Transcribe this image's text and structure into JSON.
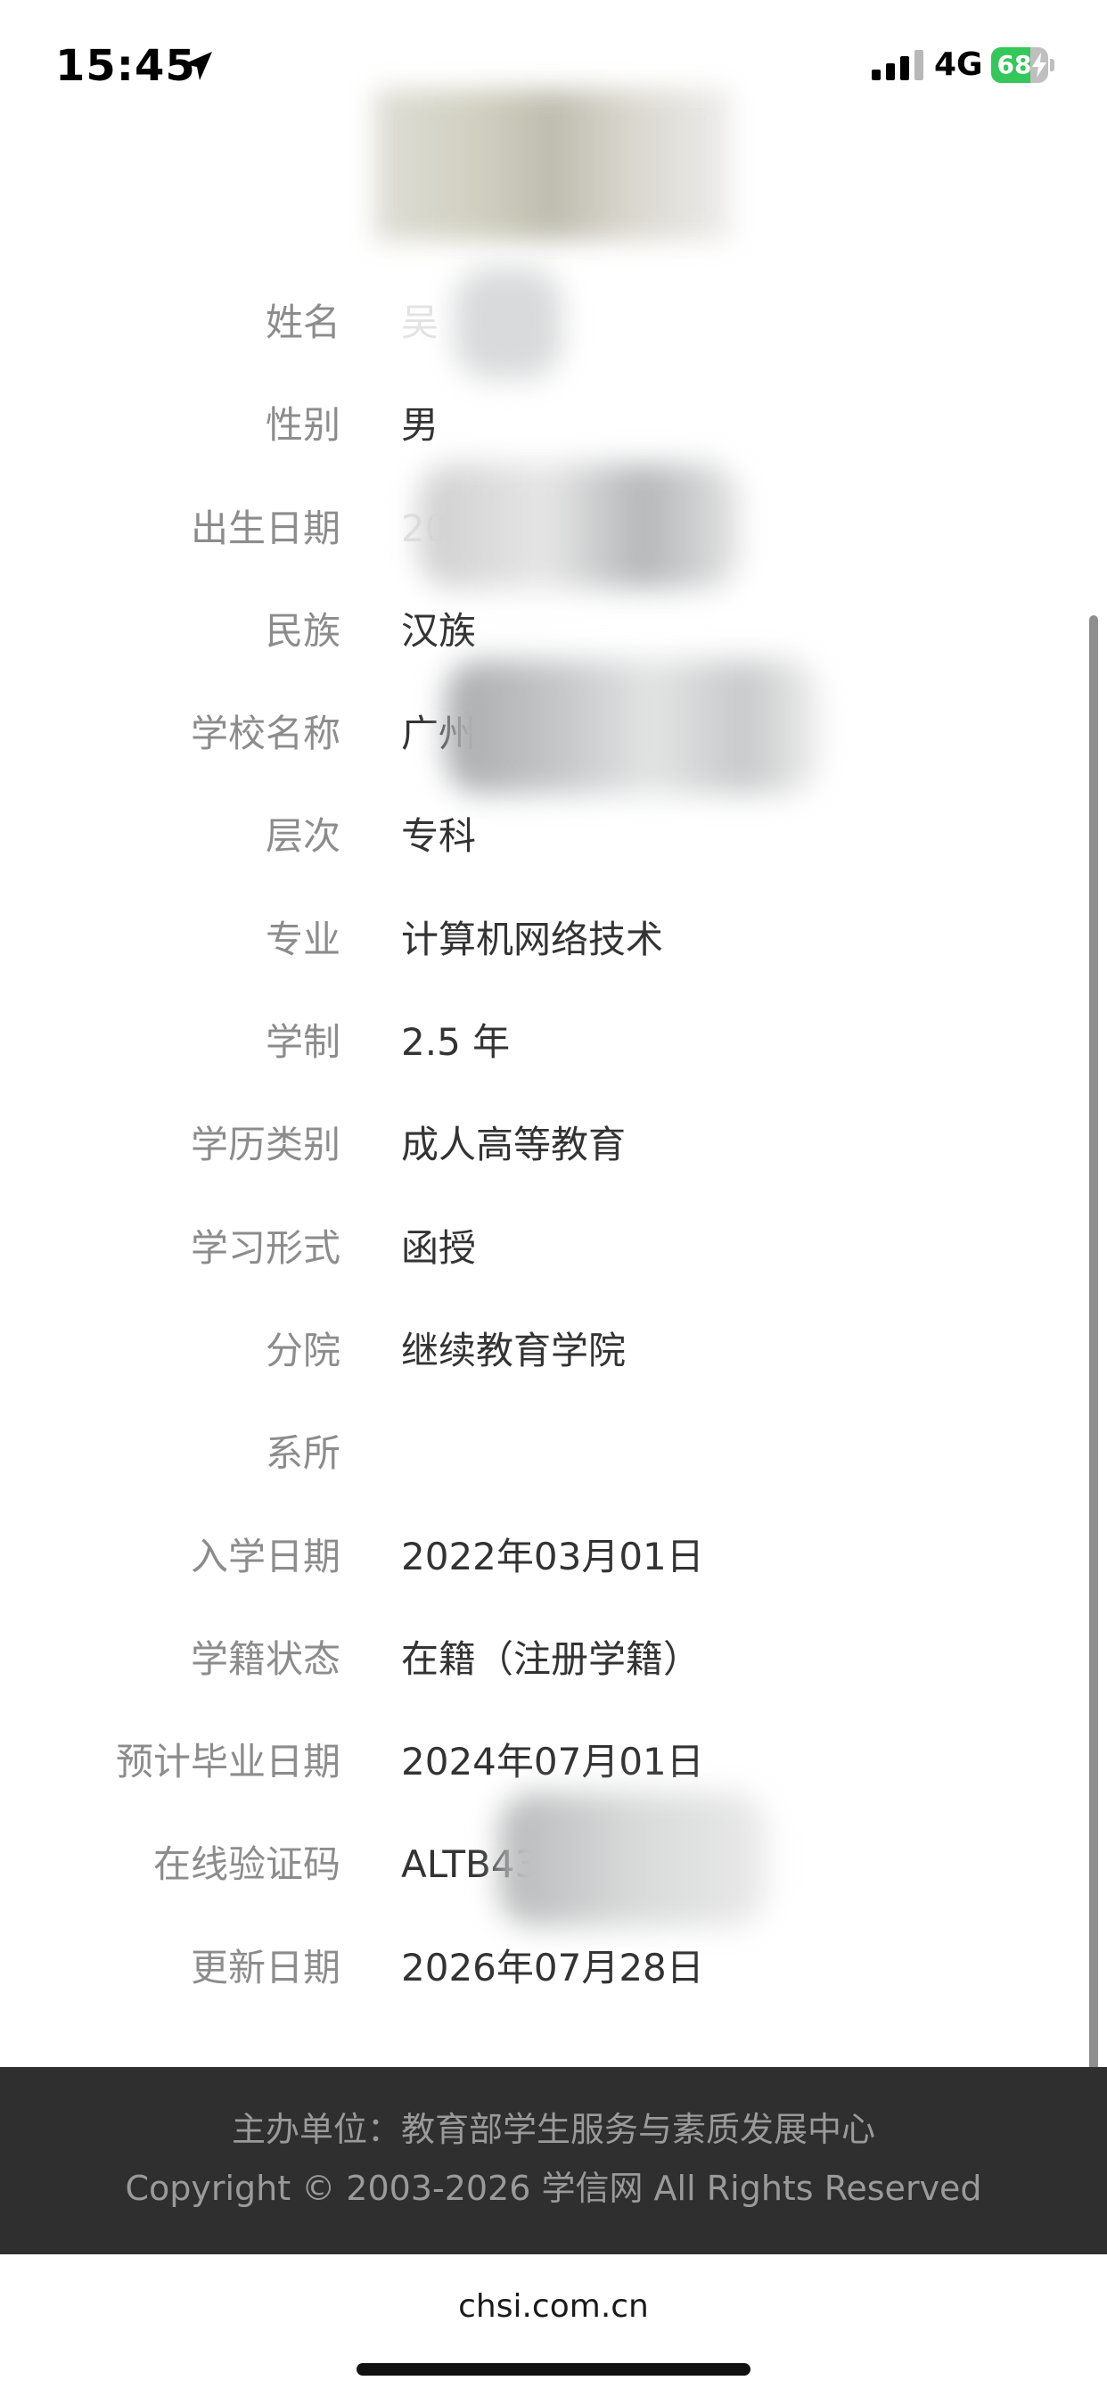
{
  "status_bar": {
    "time": "15:45",
    "network": "4G",
    "battery_level": "68",
    "battery_fraction": 0.68,
    "icons": [
      "location-arrow-icon",
      "signal-icon",
      "battery-icon",
      "charging-bolt-icon"
    ],
    "colors": {
      "battery_fill": "#34c759"
    }
  },
  "profile": {
    "photo": "blurred-photo"
  },
  "info": {
    "rows": [
      {
        "label": "姓名",
        "value": "吴"
      },
      {
        "label": "性别",
        "value": "男"
      },
      {
        "label": "出生日期",
        "value": "2000年 日"
      },
      {
        "label": "民族",
        "value": "汉族"
      },
      {
        "label": "学校名称",
        "value": "广州南"
      },
      {
        "label": "层次",
        "value": "专科"
      },
      {
        "label": "专业",
        "value": "计算机网络技术"
      },
      {
        "label": "学制",
        "value": "2.5 年"
      },
      {
        "label": "学历类别",
        "value": "成人高等教育"
      },
      {
        "label": "学习形式",
        "value": "函授"
      },
      {
        "label": "分院",
        "value": "继续教育学院"
      },
      {
        "label": "系所",
        "value": ""
      },
      {
        "label": "入学日期",
        "value": "2022年03月01日"
      },
      {
        "label": "学籍状态",
        "value": "在籍（注册学籍）"
      },
      {
        "label": "预计毕业日期",
        "value": "2024年07月01日"
      },
      {
        "label": "在线验证码",
        "value": "ALTB43"
      },
      {
        "label": "更新日期",
        "value": "2026年07月28日"
      }
    ]
  },
  "footer": {
    "sponsor": "主办单位：教育部学生服务与素质发展中心",
    "copyright": "Copyright © 2003-2026 学信网 All Rights Reserved"
  },
  "browser": {
    "url": "chsi.com.cn"
  }
}
